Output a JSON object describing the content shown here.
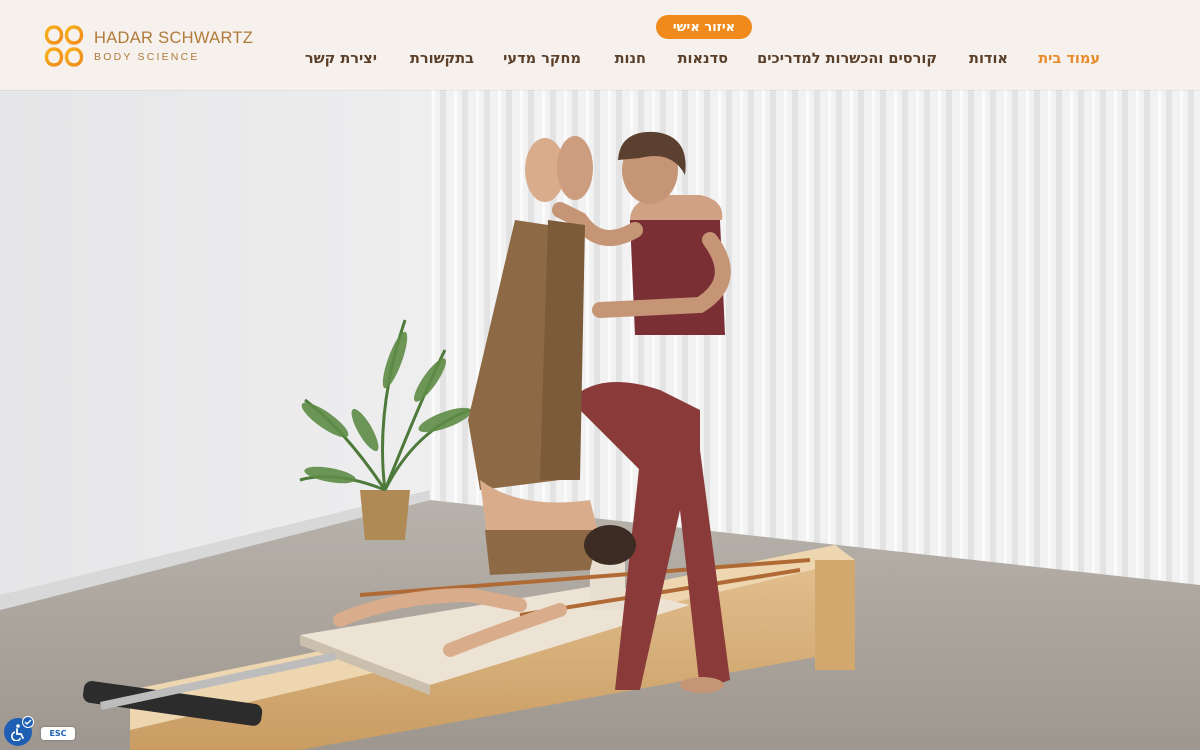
{
  "brand": {
    "title": "HADAR SCHWARTZ",
    "subtitle": "BODY SCIENCE",
    "accent": "#f08a1c"
  },
  "header": {
    "personal_area": "איזור אישי"
  },
  "nav": [
    {
      "label": "עמוד בית",
      "active": true
    },
    {
      "label": "אודות",
      "active": false
    },
    {
      "label": "קורסים והכשרות למדריכים",
      "active": false
    },
    {
      "label": "סדנאות",
      "active": false
    },
    {
      "label": "חנות",
      "active": false
    },
    {
      "label": "מחקר מדעי",
      "active": false
    },
    {
      "label": "בתקשורת",
      "active": false
    },
    {
      "label": "יצירת קשר",
      "active": false
    }
  ],
  "accessibility": {
    "icon": "wheelchair-icon",
    "esc_label": "ESC"
  }
}
